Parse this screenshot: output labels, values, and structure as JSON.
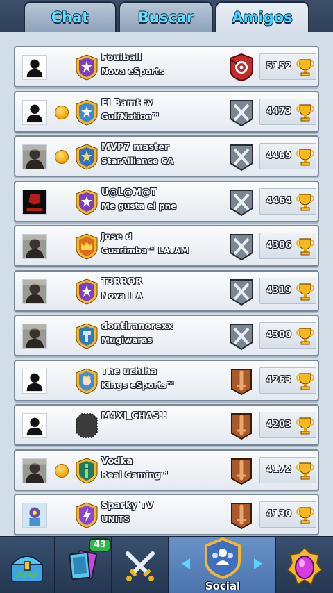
{
  "tabs": [
    {
      "label": "Chat",
      "active": false
    },
    {
      "label": "Buscar",
      "active": false
    },
    {
      "label": "Amigos",
      "active": true
    }
  ],
  "colors": {
    "tab_text": "#5ee0ff",
    "panel_bg": "#d3dde8",
    "row_bg": "#f4f7fa",
    "nav_bg": "#2f4560",
    "social_active": "#5a84bd",
    "cards_badge": "#2fb84a"
  },
  "friends": [
    {
      "name": "Fouiball",
      "clan": "Nova eSports",
      "trophies": "5152",
      "online_coin": false,
      "avatar": "default-avatar-icon",
      "badge": "purple-star-badge-icon",
      "league": "red-target-league-icon"
    },
    {
      "name": "El Bamt :v",
      "clan": "GulfNation™",
      "trophies": "4473",
      "online_coin": true,
      "avatar": "default-avatar-icon",
      "badge": "blue-snowflake-badge-icon",
      "league": "silver-swords-league-icon"
    },
    {
      "name": "MVP7 master",
      "clan": "StarAlliance CA",
      "trophies": "4469",
      "online_coin": true,
      "avatar": "photo-avatar-icon",
      "badge": "blue-star-badge-icon",
      "league": "silver-swords-league-icon"
    },
    {
      "name": "U@L@M@T",
      "clan": "Me gusta el pne",
      "trophies": "4464",
      "online_coin": false,
      "avatar": "spartan-avatar-icon",
      "badge": "purple-star-badge-icon",
      "league": "silver-swords-league-icon"
    },
    {
      "name": "Jose d",
      "clan": "Guarimba™ LATAM",
      "trophies": "4386",
      "online_coin": false,
      "avatar": "photo-avatar-icon",
      "badge": "orange-crown-badge-icon",
      "league": "silver-swords-league-icon"
    },
    {
      "name": "T3RROR",
      "clan": "Nova ITA",
      "trophies": "4319",
      "online_coin": false,
      "avatar": "photo-avatar-icon",
      "badge": "purple-star-badge-icon",
      "league": "silver-swords-league-icon"
    },
    {
      "name": "dontiranorexx",
      "clan": "Mugiwaras",
      "trophies": "4300",
      "online_coin": false,
      "avatar": "photo-avatar-icon",
      "badge": "blue-hammer-badge-icon",
      "league": "silver-swords-league-icon"
    },
    {
      "name": "The uchiha",
      "clan": "Kings eSports™",
      "trophies": "4263",
      "online_coin": false,
      "avatar": "default-avatar-icon",
      "badge": "blue-king-badge-icon",
      "league": "bronze-sword-league-icon"
    },
    {
      "name": "M4XI_CHAS!!",
      "clan": "",
      "trophies": "4203",
      "online_coin": false,
      "avatar": "default-avatar-icon",
      "badge": "empty-clan-badge-icon",
      "league": "bronze-sword-league-icon"
    },
    {
      "name": "Vodka",
      "clan": "Real Gaming™",
      "trophies": "4172",
      "online_coin": true,
      "avatar": "photo-avatar-icon",
      "badge": "blue-bamboo-badge-icon",
      "league": "bronze-sword-league-icon"
    },
    {
      "name": "SparKy TV",
      "clan": "UNITS",
      "trophies": "4130",
      "online_coin": false,
      "avatar": "sparky-avatar-icon",
      "badge": "purple-lightning-badge-icon",
      "league": "bronze-sword-league-icon"
    }
  ],
  "bottom_nav": {
    "shop": {
      "icon": "treasure-chest-icon"
    },
    "cards": {
      "icon": "cards-icon",
      "badge": "43"
    },
    "battle": {
      "icon": "crossed-swords-icon"
    },
    "social": {
      "icon": "social-people-icon",
      "label": "Social",
      "active": true
    },
    "events": {
      "icon": "purple-egg-icon"
    }
  }
}
